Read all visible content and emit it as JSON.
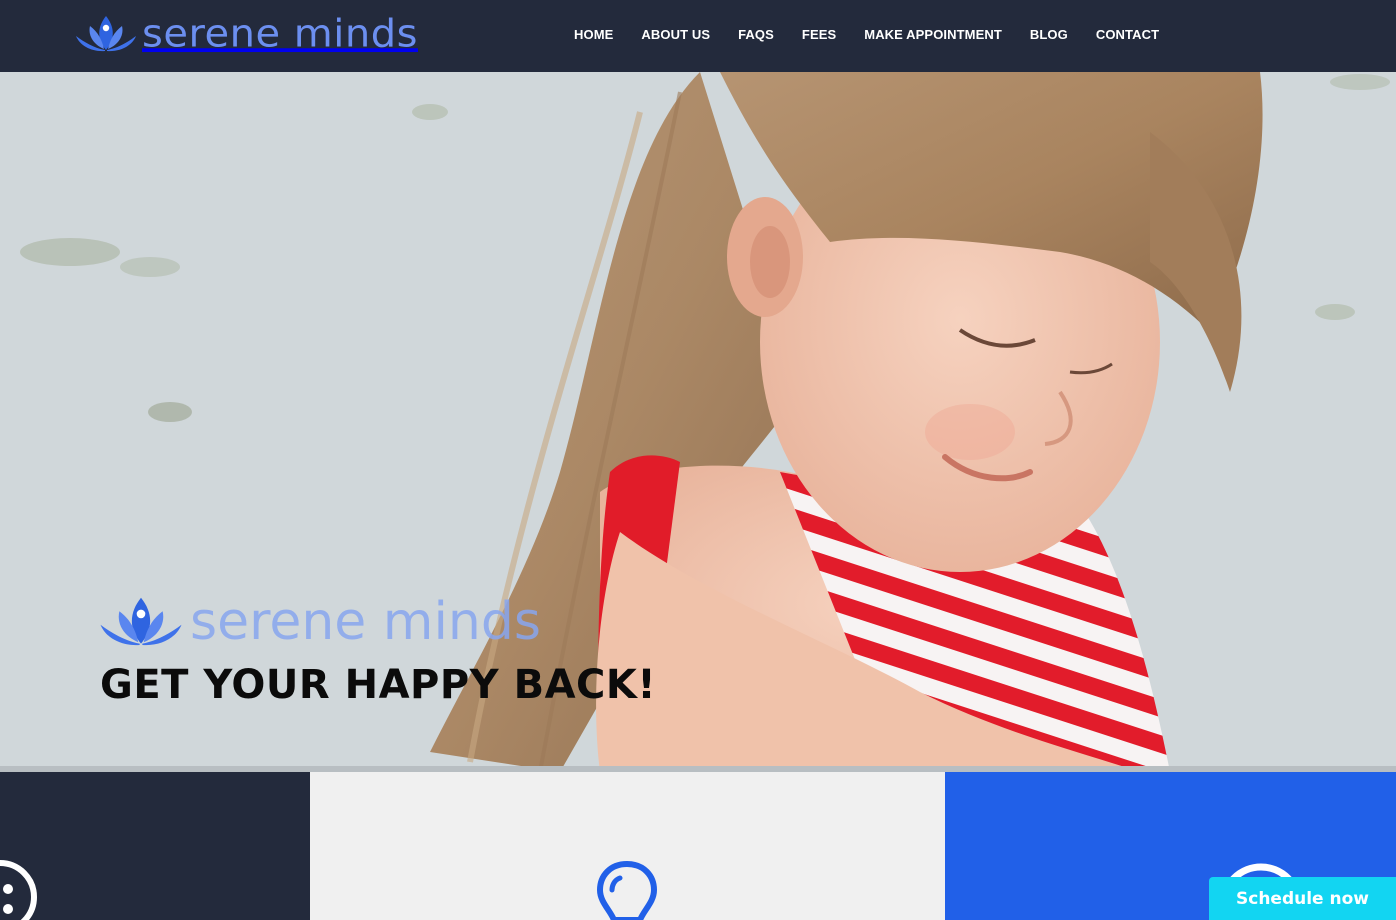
{
  "header": {
    "logo_text": "serene minds",
    "logo_icon": "lotus-icon",
    "nav": {
      "home": "HOME",
      "about": "ABOUT US",
      "faqs": "FAQS",
      "fees": "FEES",
      "appointment": "MAKE APPOINTMENT",
      "blog": "BLOG",
      "contact": "CONTACT"
    }
  },
  "hero": {
    "image": "smiling-girl-striped-dress-photo",
    "logo_text": "serene minds",
    "tagline": "GET YOUR HAPPY BACK!"
  },
  "features": [
    {
      "icon": "smiley-face-icon",
      "color": "#232a3c"
    },
    {
      "icon": "lightbulb-icon",
      "color": "#f0f0f0"
    },
    {
      "icon": "circle-icon",
      "color": "#2160e8"
    }
  ],
  "cta": {
    "schedule_label": "Schedule now"
  },
  "colors": {
    "header_bg": "#232a3c",
    "brand_blue": "#2160e8",
    "logo_blue": "#6c8ff0",
    "cta_cyan": "#12d5f2"
  }
}
